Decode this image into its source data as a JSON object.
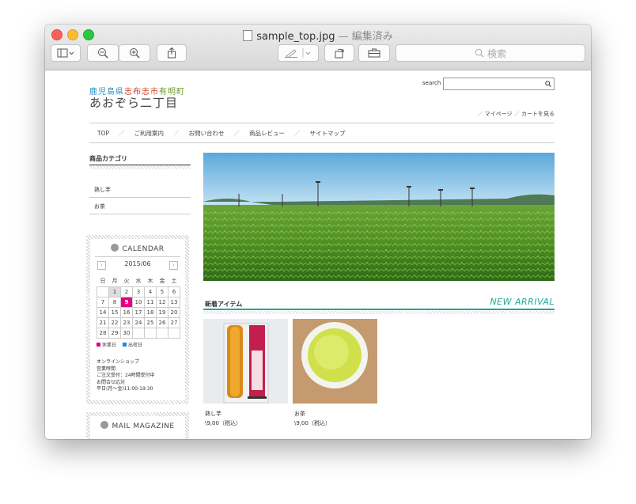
{
  "window": {
    "filename": "sample_top.jpg",
    "separator": "—",
    "status": "編集済み",
    "search_placeholder": "検索"
  },
  "site": {
    "logo_top": [
      "鹿児島県",
      "志布志市",
      "有明町"
    ],
    "logo_main": "あおぞら二丁目",
    "search_label": "search",
    "util_links": [
      "マイページ",
      "カートを見る"
    ],
    "nav": [
      "TOP",
      "ご利用案内",
      "お問い合わせ",
      "商品レビュー",
      "サイトマップ"
    ],
    "category_title": "商品カテゴリ",
    "categories": [
      "熟し芋",
      "お茶"
    ],
    "calendar": {
      "title": "CALENDAR",
      "month": "2015/06",
      "weekdays": [
        "日",
        "月",
        "火",
        "水",
        "木",
        "金",
        "土"
      ],
      "rows": [
        [
          "",
          "1",
          "2",
          "3",
          "4",
          "5",
          "6"
        ],
        [
          "7",
          "8",
          "9",
          "10",
          "11",
          "12",
          "13"
        ],
        [
          "14",
          "15",
          "16",
          "17",
          "18",
          "19",
          "20"
        ],
        [
          "21",
          "22",
          "23",
          "24",
          "25",
          "26",
          "27"
        ],
        [
          "28",
          "29",
          "30",
          "",
          "",
          "",
          ""
        ]
      ],
      "legend_holiday": "休業日",
      "legend_ship": "出荷日",
      "holiday_color": "#e4007f",
      "ship_color": "#1e88e5"
    },
    "shop_info": [
      "オンラインショップ",
      "営業時間",
      "ご注文受付：24時間受付中",
      "お問合せ応対",
      "平日(月〜金)11:00-19:30"
    ],
    "mail_title": "MAIL MAGAZINE",
    "new_items_title": "新着アイテム",
    "new_items_en": "NEW ARRIVAL",
    "accent_color": "#20a89a",
    "products": [
      {
        "name": "熟し芋",
        "price": "\\9,00（税込）"
      },
      {
        "name": "お茶",
        "price": "\\9,00（税込）"
      }
    ]
  }
}
